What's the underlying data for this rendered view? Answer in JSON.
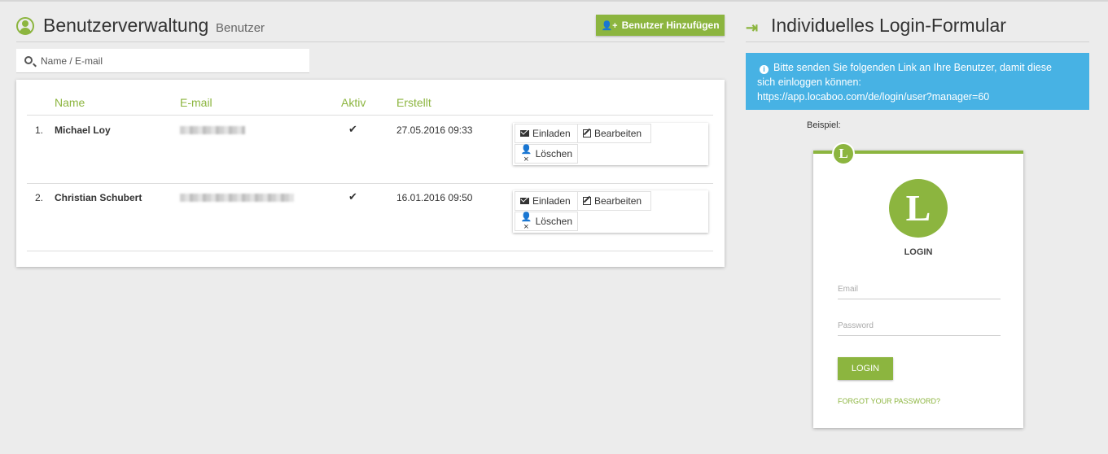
{
  "left": {
    "title": "Benutzerverwaltung",
    "subtitle": "Benutzer",
    "add_button": "Benutzer Hinzufügen",
    "search_placeholder": "Name / E-mail",
    "columns": {
      "name": "Name",
      "email": "E-mail",
      "active": "Aktiv",
      "created": "Erstellt"
    },
    "rows": [
      {
        "num": "1.",
        "name": "Michael Loy",
        "active": "✔",
        "created": "27.05.2016 09:33"
      },
      {
        "num": "2.",
        "name": "Christian Schubert",
        "active": "✔",
        "created": "16.01.2016 09:50"
      }
    ],
    "actions": {
      "invite": "Einladen",
      "edit": "Bearbeiten",
      "delete": "Löschen"
    }
  },
  "right": {
    "title": "Individuelles Login-Formular",
    "info_line1": "Bitte senden Sie folgenden Link an Ihre Benutzer, damit diese",
    "info_line2": "sich einloggen können:",
    "info_link": "https://app.locaboo.com/de/login/user?manager=60",
    "example_label": "Beispiel:",
    "preview": {
      "logo_letter": "L",
      "login_title": "LOGIN",
      "email_placeholder": "Email",
      "password_placeholder": "Password",
      "login_button": "LOGIN",
      "forgot": "FORGOT YOUR PASSWORD?"
    }
  },
  "colors": {
    "accent": "#8cb53f",
    "info": "#47b2e4"
  }
}
